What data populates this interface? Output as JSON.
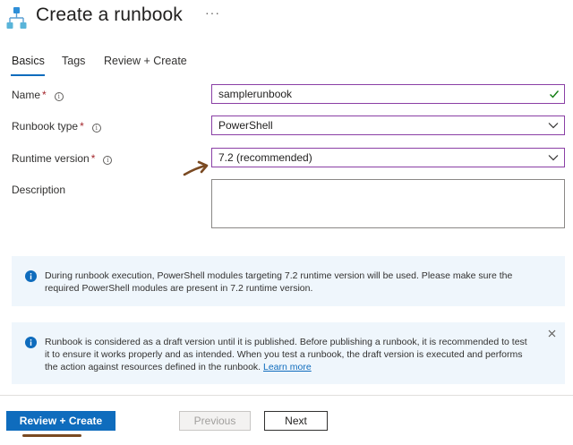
{
  "header": {
    "title": "Create a runbook",
    "more_label": "···",
    "icon": "runbook-hierarchy-icon"
  },
  "tabs": [
    {
      "label": "Basics",
      "active": true
    },
    {
      "label": "Tags",
      "active": false
    },
    {
      "label": "Review + Create",
      "active": false
    }
  ],
  "form": {
    "name": {
      "label": "Name",
      "required": "*",
      "value": "samplerunbook",
      "valid": true
    },
    "runbook_type": {
      "label": "Runbook type",
      "required": "*",
      "value": "PowerShell"
    },
    "runtime_version": {
      "label": "Runtime version",
      "required": "*",
      "value": "7.2 (recommended)"
    },
    "description": {
      "label": "Description",
      "value": ""
    }
  },
  "info_runtime": {
    "text": "During runbook execution, PowerShell modules targeting 7.2 runtime version will be used. Please make sure the required PowerShell modules are present in 7.2 runtime version."
  },
  "info_draft": {
    "text": "Runbook is considered as a draft version until it is published. Before publishing a runbook, it is recommended to test it to ensure it works properly and as intended. When you test a runbook, the draft version is executed and performs the action against resources defined in the runbook.",
    "link": "Learn more"
  },
  "footer": {
    "review_create": "Review + Create",
    "previous": "Previous",
    "next": "Next"
  },
  "colors": {
    "accent": "#0f6cbd",
    "focus_border": "#8a3fa5",
    "info_bg": "#eff6fc",
    "valid": "#107c10",
    "annotation": "#7a4a22"
  }
}
